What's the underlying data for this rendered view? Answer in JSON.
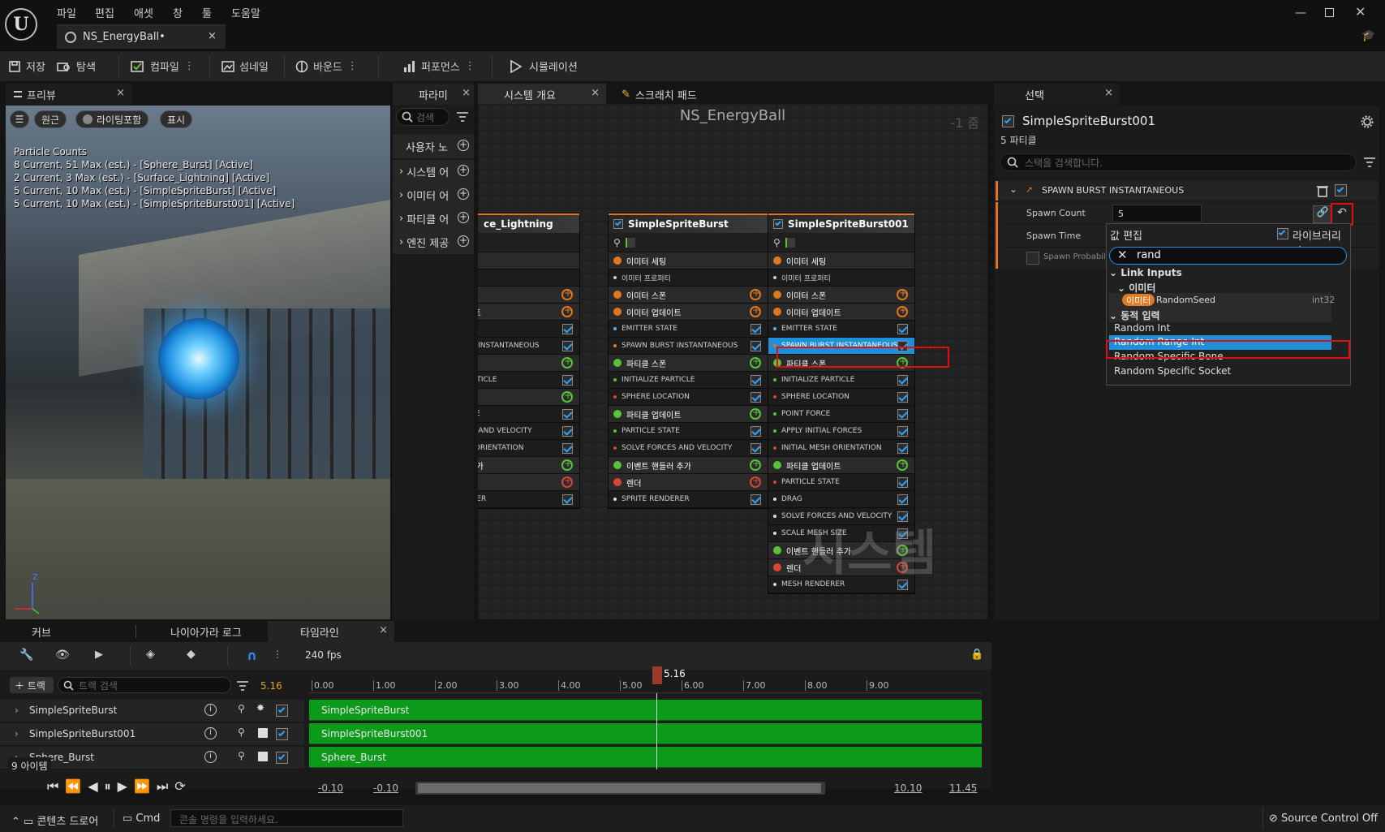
{
  "app": {
    "menu": [
      "파일",
      "편집",
      "애셋",
      "창",
      "툴",
      "도움말"
    ],
    "document_tab": "NS_EnergyBall•"
  },
  "toolbar": {
    "save": "저장",
    "browse": "탐색",
    "compile": "컴파일",
    "thumbnail": "섬네일",
    "bounds": "바운드",
    "performance": "퍼포먼스",
    "simulation": "시뮬레이션"
  },
  "preview": {
    "tab": "프리뷰",
    "perspective": "원근",
    "lighting": "라이팅포함",
    "show": "표시",
    "particle_title": "Particle Counts",
    "particle_lines": [
      "8 Current, 51 Max (est.) - [Sphere_Burst] [Active]",
      "2 Current, 3 Max (est.) - [Surface_Lightning] [Active]",
      "5 Current, 10 Max (est.) - [SimpleSpriteBurst] [Active]",
      "5 Current, 10 Max (est.) - [SimpleSpriteBurst001] [Active]"
    ]
  },
  "params": {
    "tab": "파라미",
    "search_placeholder": "검색",
    "groups": [
      "사용자 노",
      "시스템 어",
      "이미터 어",
      "파티클 어",
      "엔진 제공"
    ]
  },
  "graph": {
    "tab_overview": "시스템 개요",
    "tab_scratch": "스크래치 패드",
    "title": "NS_EnergyBall",
    "zoom": "-1 줌",
    "watermark": "시스템",
    "node_partial": {
      "title": "ce_Lightning",
      "rows": [
        "세팅",
        "프로퍼티",
        "폰",
        "업데이트",
        "I STATE",
        "BURST INSTANTANEOUS",
        "폰",
        "ZE PARTICLE",
        "데이트",
        "E STATE",
        "ORCES AND VELOCITY",
        "MESH ORIENTATION",
        "들러 추가",
        "",
        "ENDERER"
      ]
    },
    "node_a": {
      "title": "SimpleSpriteBurst",
      "rows": [
        "이미터 세팅",
        "이미터 프로퍼티",
        "이미터 스폰",
        "이미터 업데이트",
        "EMITTER STATE",
        "SPAWN BURST INSTANTANEOUS",
        "파티클 스폰",
        "INITIALIZE PARTICLE",
        "SPHERE LOCATION",
        "파티클 업데이트",
        "PARTICLE STATE",
        "SOLVE FORCES AND VELOCITY",
        "이벤트 핸들러 추가",
        "렌더",
        "SPRITE RENDERER"
      ]
    },
    "node_b": {
      "title": "SimpleSpriteBurst001",
      "rows": [
        "이미터 세팅",
        "이미터 프로퍼티",
        "이미터 스폰",
        "이미터 업데이트",
        "EMITTER STATE",
        "SPAWN BURST INSTANTANEOUS",
        "파티클 스폰",
        "INITIALIZE PARTICLE",
        "SPHERE LOCATION",
        "POINT FORCE",
        "APPLY INITIAL FORCES",
        "INITIAL MESH ORIENTATION",
        "파티클 업데이트",
        "PARTICLE STATE",
        "DRAG",
        "SOLVE FORCES AND VELOCITY",
        "SCALE MESH SIZE",
        "이벤트 핸들러 추가",
        "렌더",
        "MESH RENDERER"
      ]
    }
  },
  "details": {
    "tab": "선택",
    "emitter_name": "SimpleSpriteBurst001",
    "subtitle": "5 파티클",
    "search_placeholder": "스택을 검색합니다.",
    "section": "SPAWN BURST INSTANTANEOUS",
    "spawn_count_label": "Spawn Count",
    "spawn_count_value": "5",
    "spawn_time_label": "Spawn Time",
    "spawn_prob_label": "Spawn Probabil"
  },
  "dropdown": {
    "title": "값 편집",
    "library_only": "라이브러리만",
    "search_value": "rand",
    "link_inputs": "Link Inputs",
    "emitter_group": "이미터",
    "emitter_badge": "이미터",
    "random_seed": "RandomSeed",
    "random_seed_type": "int32",
    "dynamic_inputs": "동적 입력",
    "items": [
      "Random Int",
      "Random Range Int",
      "Random Specific Bone",
      "Random Specific Socket"
    ]
  },
  "bottom": {
    "tabs": [
      "커브",
      "나이아가라 로그",
      "타임라인"
    ],
    "fps": "240 fps",
    "add_track": "트랙",
    "track_search": "트랙 검색",
    "current_time": "5.16",
    "playhead_label": "5.16",
    "ruler": [
      "0.00",
      "1.00",
      "2.00",
      "3.00",
      "4.00",
      "5.00",
      "6.00",
      "7.00",
      "8.00",
      "9.00"
    ],
    "tracks": [
      "SimpleSpriteBurst",
      "SimpleSpriteBurst001",
      "Sphere_Burst"
    ],
    "items_count": "9 아이템",
    "range_start_a": "-0.10",
    "range_start_b": "-0.10",
    "range_end_a": "10.10",
    "range_end_b": "11.45"
  },
  "statusbar": {
    "content_drawer": "콘텐츠 드로어",
    "cmd": "Cmd",
    "cmd_placeholder": "콘솔 명령을 입력하세요.",
    "source_control": "Source Control Off"
  },
  "colors": {
    "accent_orange": "#e0771e",
    "timeline_green": "#0b9a1a",
    "highlight_blue": "#1e8fd8",
    "selection_red": "#e01010"
  }
}
